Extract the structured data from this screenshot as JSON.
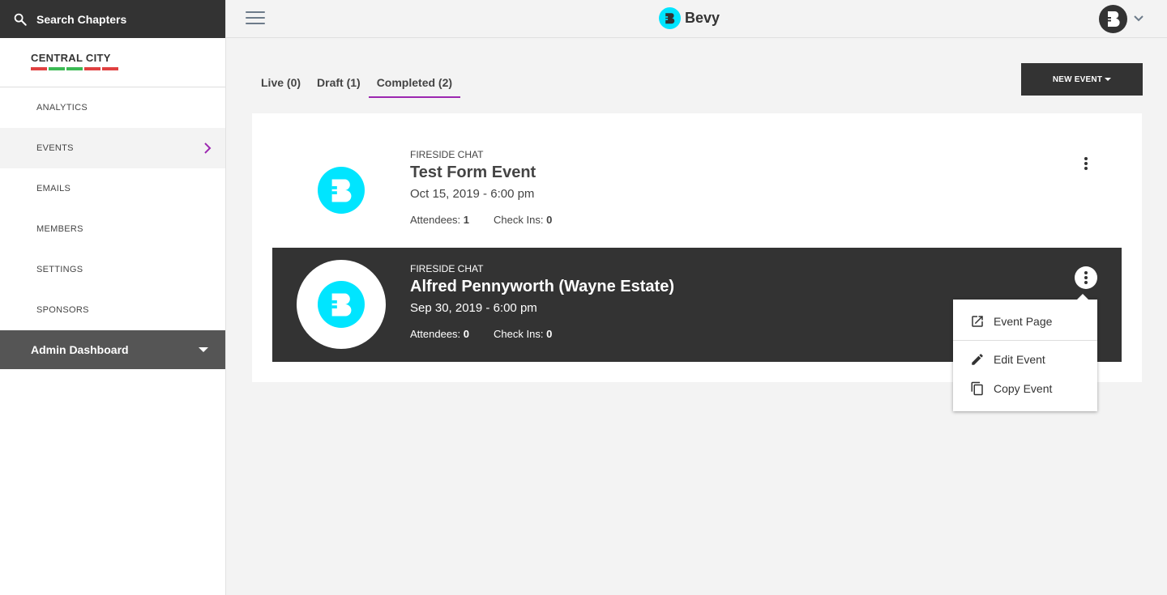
{
  "app": {
    "brand_name": "Bevy",
    "accent_color": "#00e5ff",
    "active_color": "#9c27b0"
  },
  "sidebar": {
    "search_label": "Search Chapters",
    "chapter_name": "CENTRAL CITY",
    "chapter_stripe_colors": [
      "#e04040",
      "#3cba54",
      "#3cba54",
      "#e04040",
      "#e04040"
    ],
    "nav_items": [
      {
        "label": "ANALYTICS"
      },
      {
        "label": "EVENTS"
      },
      {
        "label": "EMAILS"
      },
      {
        "label": "MEMBERS"
      },
      {
        "label": "SETTINGS"
      },
      {
        "label": "SPONSORS"
      }
    ],
    "active_item": "EVENTS",
    "admin_label": "Admin Dashboard"
  },
  "tabs": [
    {
      "label": "Live (0)"
    },
    {
      "label": "Draft (1)"
    },
    {
      "label": "Completed (2)"
    }
  ],
  "active_tab": "Completed (2)",
  "new_event_label": "NEW EVENT",
  "events": [
    {
      "type": "FIRESIDE CHAT",
      "title": "Test Form Event",
      "date": "Oct 15, 2019 - 6:00 pm",
      "attendees_label": "Attendees:",
      "attendees_value": "1",
      "checkins_label": "Check Ins:",
      "checkins_value": "0"
    },
    {
      "type": "FIRESIDE CHAT",
      "title": "Alfred Pennyworth (Wayne Estate)",
      "date": "Sep 30, 2019 - 6:00 pm",
      "attendees_label": "Attendees:",
      "attendees_value": "0",
      "checkins_label": "Check Ins:",
      "checkins_value": "0"
    }
  ],
  "event_menu": {
    "items": [
      {
        "label": "Event Page",
        "icon": "open-in-new-icon"
      },
      {
        "label": "Edit Event",
        "icon": "pencil-icon"
      },
      {
        "label": "Copy Event",
        "icon": "copy-icon"
      }
    ]
  }
}
